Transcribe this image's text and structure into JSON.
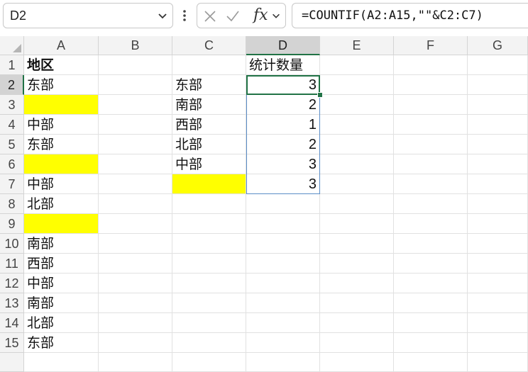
{
  "name_box": {
    "value": "D2"
  },
  "formula_bar": {
    "fx_label": "fx",
    "formula": "=COUNTIF(A2:A15,\"\"&C2:C7)"
  },
  "columns": [
    "A",
    "B",
    "C",
    "D",
    "E",
    "F",
    "G"
  ],
  "rows": [
    "1",
    "2",
    "3",
    "4",
    "5",
    "6",
    "7",
    "8",
    "9",
    "10",
    "11",
    "12",
    "13",
    "14",
    "15"
  ],
  "selected": {
    "column": "D",
    "row": "2"
  },
  "colors": {
    "highlight_fill": "#ffff00",
    "selection_green": "#217346"
  },
  "cells": {
    "A1": "地区",
    "A2": "东部",
    "A3": "",
    "A4": "中部",
    "A5": "东部",
    "A6": "",
    "A7": "中部",
    "A8": "北部",
    "A9": "",
    "A10": "南部",
    "A11": "西部",
    "A12": "中部",
    "A13": "南部",
    "A14": "北部",
    "A15": "东部",
    "C2": "东部",
    "C3": "南部",
    "C4": "西部",
    "C5": "北部",
    "C6": "中部",
    "C7": "",
    "D1": "统计数量",
    "D2": "3",
    "D3": "2",
    "D4": "1",
    "D5": "2",
    "D6": "3",
    "D7": "3"
  }
}
